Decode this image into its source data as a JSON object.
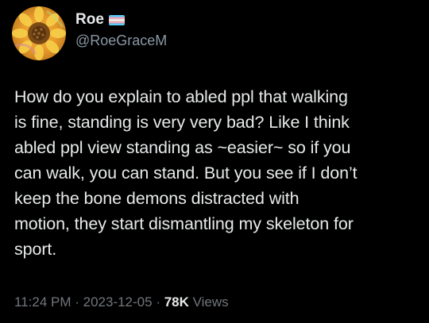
{
  "author": {
    "display_name": "Roe",
    "handle": "@RoeGraceM",
    "avatar_icon": "sunflower-avatar-icon",
    "flag_icon": "transgender-flag-icon",
    "flag_colors": [
      "#5bcefa",
      "#f5a9b8",
      "#ffffff",
      "#f5a9b8",
      "#5bcefa"
    ]
  },
  "tweet": {
    "text": "How do you explain to abled ppl that walking\nis fine, standing is very very bad? Like I think\nabled ppl view standing as ~easier~ so if you\ncan walk, you can stand. But you see if I don’t\nkeep the bone demons distracted with\nmotion, they start dismantling my skeleton for\nsport."
  },
  "meta": {
    "time": "11:24 PM",
    "separator": " · ",
    "date": "2023-12-05",
    "views_count": "78K",
    "views_label": "Views"
  },
  "colors": {
    "background": "#000000",
    "primary_text": "#e7e9ea",
    "secondary_text": "#71767b"
  }
}
